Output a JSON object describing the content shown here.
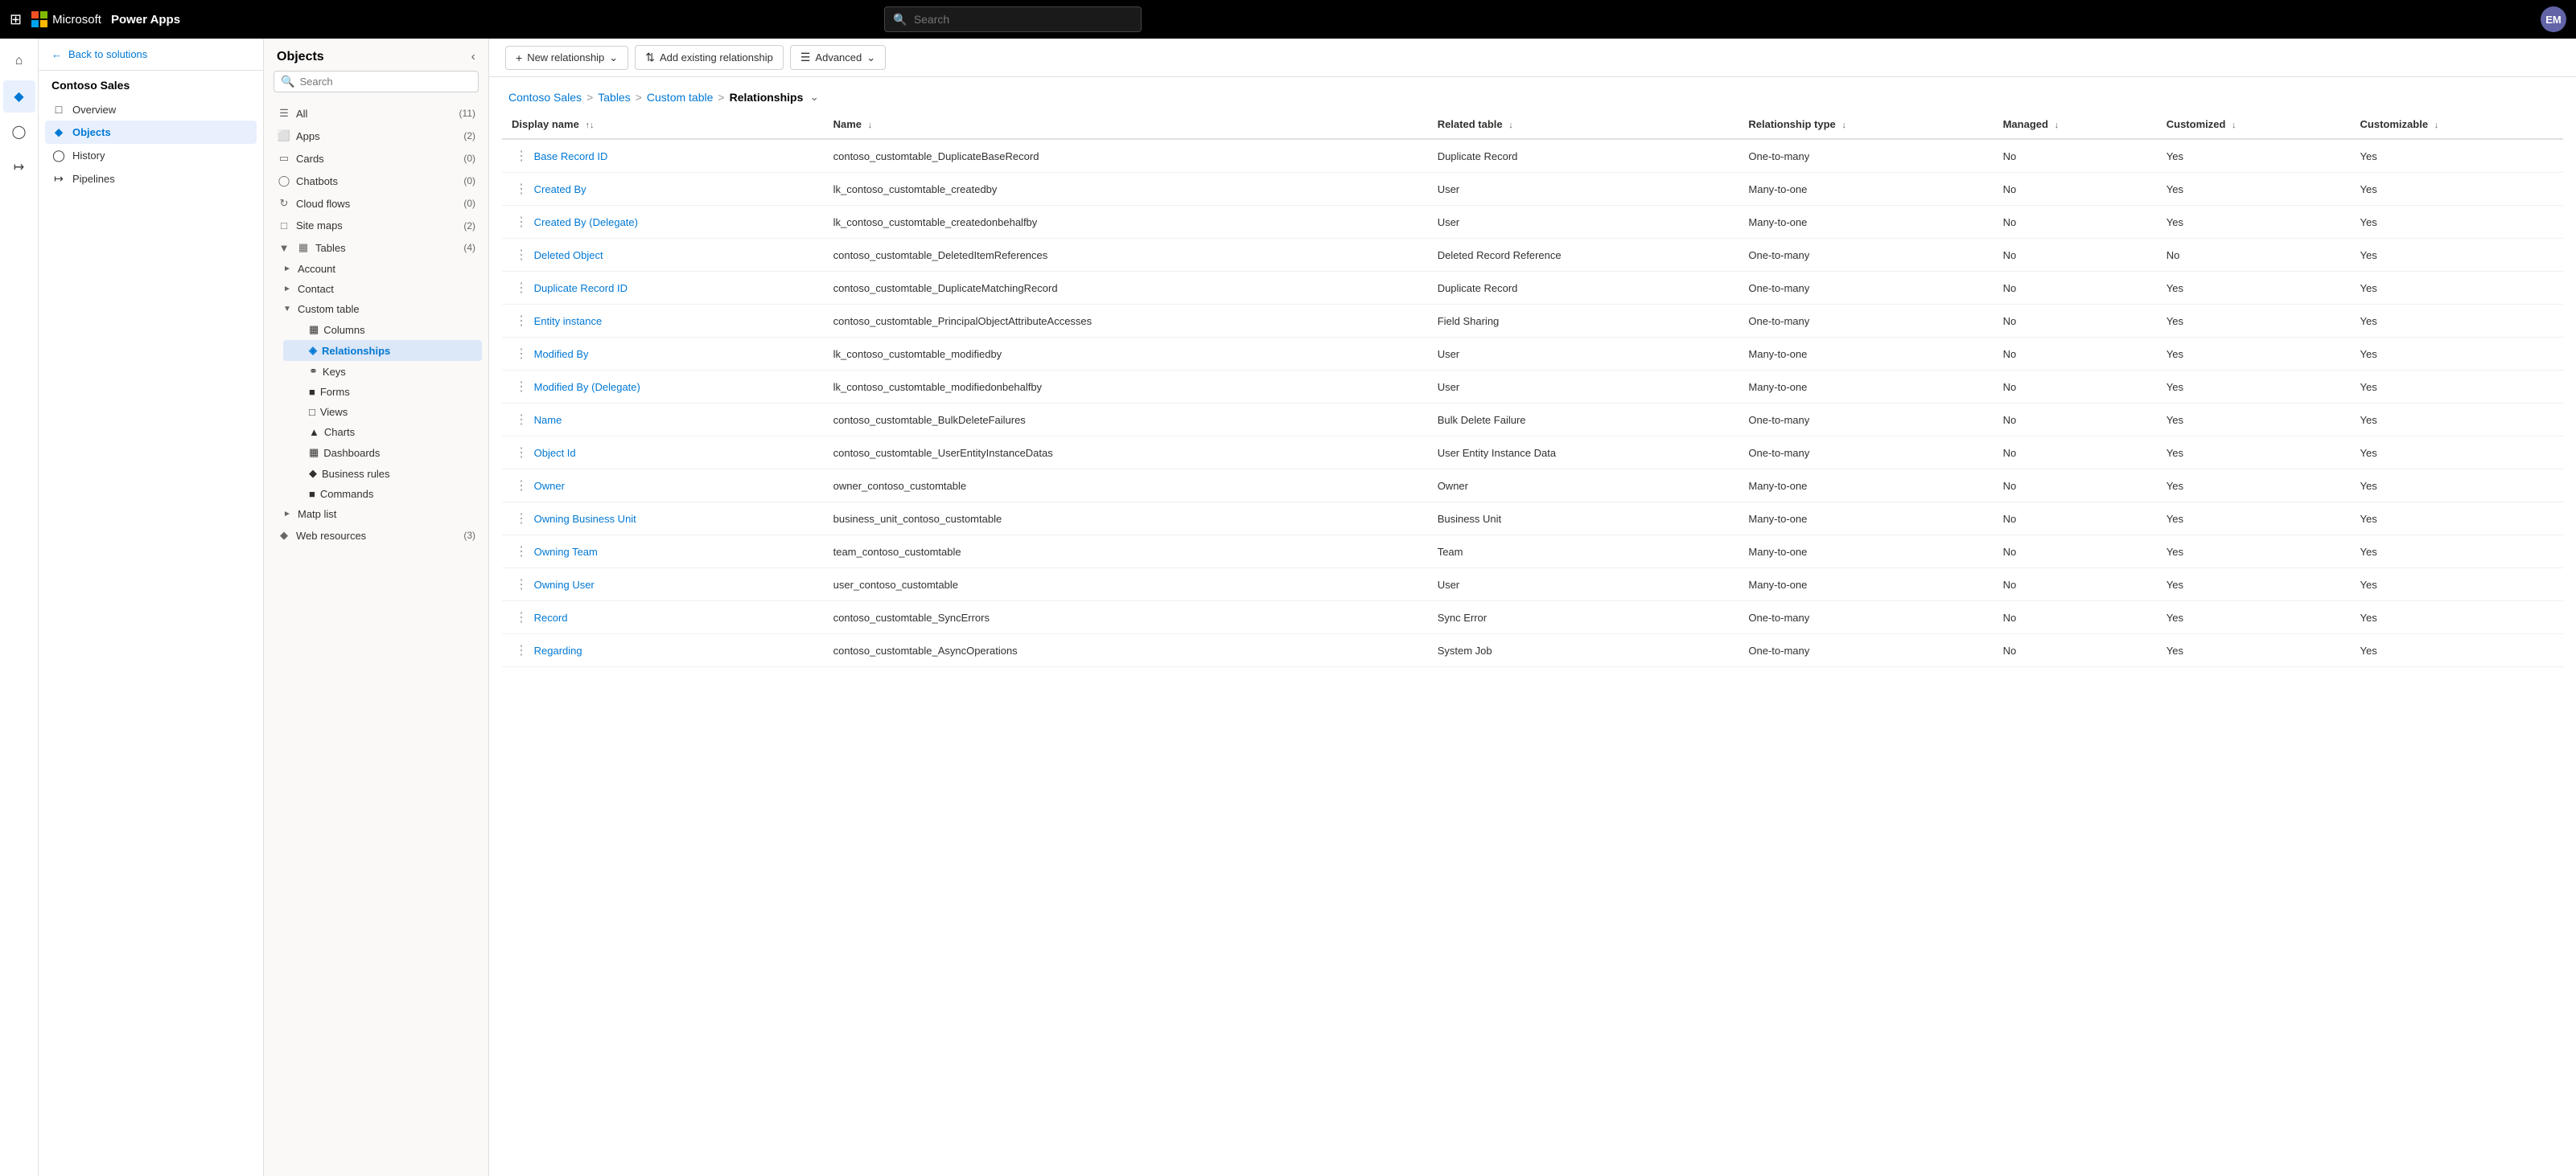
{
  "topNav": {
    "waffle": "⊞",
    "msText": "Microsoft",
    "appName": "Power Apps",
    "searchPlaceholder": "Search",
    "userInitials": "EM"
  },
  "leftNav": {
    "backLabel": "Back to solutions",
    "solutionName": "Contoso Sales",
    "items": [
      {
        "id": "overview",
        "icon": "◻",
        "label": "Overview"
      },
      {
        "id": "objects",
        "icon": "◈",
        "label": "Objects",
        "active": true
      },
      {
        "id": "history",
        "icon": "◷",
        "label": "History"
      },
      {
        "id": "pipelines",
        "icon": "⟼",
        "label": "Pipelines"
      }
    ]
  },
  "objectsPanel": {
    "title": "Objects",
    "searchPlaceholder": "Search",
    "items": [
      {
        "id": "all",
        "icon": "☰",
        "label": "All",
        "count": "(11)"
      },
      {
        "id": "apps",
        "icon": "⬚",
        "label": "Apps",
        "count": "(2)"
      },
      {
        "id": "cards",
        "icon": "▭",
        "label": "Cards",
        "count": "(0)"
      },
      {
        "id": "chatbots",
        "icon": "◉",
        "label": "Chatbots",
        "count": "(0)"
      },
      {
        "id": "cloudflows",
        "icon": "↻",
        "label": "Cloud flows",
        "count": "(0)"
      },
      {
        "id": "sitemaps",
        "icon": "⬜",
        "label": "Site maps",
        "count": "(2)"
      },
      {
        "id": "tables",
        "icon": "▦",
        "label": "Tables",
        "count": "(4)",
        "expanded": true,
        "children": [
          {
            "id": "account",
            "label": "Account",
            "expanded": false
          },
          {
            "id": "contact",
            "label": "Contact",
            "expanded": false
          },
          {
            "id": "customtable",
            "label": "Custom table",
            "expanded": true,
            "children": [
              {
                "id": "columns",
                "label": "Columns"
              },
              {
                "id": "relationships",
                "label": "Relationships",
                "active": true
              },
              {
                "id": "keys",
                "label": "Keys"
              },
              {
                "id": "forms",
                "label": "Forms"
              },
              {
                "id": "views",
                "label": "Views"
              },
              {
                "id": "charts",
                "label": "Charts"
              },
              {
                "id": "dashboards",
                "label": "Dashboards"
              },
              {
                "id": "businessrules",
                "label": "Business rules"
              },
              {
                "id": "commands",
                "label": "Commands"
              }
            ]
          },
          {
            "id": "maplist",
            "label": "Matp list",
            "expanded": false
          }
        ]
      },
      {
        "id": "webresources",
        "icon": "◈",
        "label": "Web resources",
        "count": "(3)"
      }
    ]
  },
  "toolbar": {
    "newRelationshipLabel": "New relationship",
    "addExistingLabel": "Add existing relationship",
    "advancedLabel": "Advanced"
  },
  "breadcrumb": {
    "items": [
      "Contoso Sales",
      "Tables",
      "Custom table"
    ],
    "current": "Relationships"
  },
  "table": {
    "columns": [
      {
        "id": "displayname",
        "label": "Display name",
        "sortable": true,
        "sortDir": "asc"
      },
      {
        "id": "name",
        "label": "Name",
        "sortable": true
      },
      {
        "id": "relatedtable",
        "label": "Related table",
        "sortable": true
      },
      {
        "id": "relationshiptype",
        "label": "Relationship type",
        "sortable": true
      },
      {
        "id": "managed",
        "label": "Managed",
        "sortable": true
      },
      {
        "id": "customized",
        "label": "Customized",
        "sortable": true
      },
      {
        "id": "customizable",
        "label": "Customizable",
        "sortable": true
      }
    ],
    "rows": [
      {
        "displayName": "Base Record ID",
        "name": "contoso_customtable_DuplicateBaseRecord",
        "relatedTable": "Duplicate Record",
        "relationshipType": "One-to-many",
        "managed": "No",
        "customized": "Yes",
        "customizable": "Yes"
      },
      {
        "displayName": "Created By",
        "name": "lk_contoso_customtable_createdby",
        "relatedTable": "User",
        "relationshipType": "Many-to-one",
        "managed": "No",
        "customized": "Yes",
        "customizable": "Yes"
      },
      {
        "displayName": "Created By (Delegate)",
        "name": "lk_contoso_customtable_createdonbehalfby",
        "relatedTable": "User",
        "relationshipType": "Many-to-one",
        "managed": "No",
        "customized": "Yes",
        "customizable": "Yes"
      },
      {
        "displayName": "Deleted Object",
        "name": "contoso_customtable_DeletedItemReferences",
        "relatedTable": "Deleted Record Reference",
        "relationshipType": "One-to-many",
        "managed": "No",
        "customized": "No",
        "customizable": "Yes"
      },
      {
        "displayName": "Duplicate Record ID",
        "name": "contoso_customtable_DuplicateMatchingRecord",
        "relatedTable": "Duplicate Record",
        "relationshipType": "One-to-many",
        "managed": "No",
        "customized": "Yes",
        "customizable": "Yes"
      },
      {
        "displayName": "Entity instance",
        "name": "contoso_customtable_PrincipalObjectAttributeAccesses",
        "relatedTable": "Field Sharing",
        "relationshipType": "One-to-many",
        "managed": "No",
        "customized": "Yes",
        "customizable": "Yes"
      },
      {
        "displayName": "Modified By",
        "name": "lk_contoso_customtable_modifiedby",
        "relatedTable": "User",
        "relationshipType": "Many-to-one",
        "managed": "No",
        "customized": "Yes",
        "customizable": "Yes"
      },
      {
        "displayName": "Modified By (Delegate)",
        "name": "lk_contoso_customtable_modifiedonbehalfby",
        "relatedTable": "User",
        "relationshipType": "Many-to-one",
        "managed": "No",
        "customized": "Yes",
        "customizable": "Yes"
      },
      {
        "displayName": "Name",
        "name": "contoso_customtable_BulkDeleteFailures",
        "relatedTable": "Bulk Delete Failure",
        "relationshipType": "One-to-many",
        "managed": "No",
        "customized": "Yes",
        "customizable": "Yes"
      },
      {
        "displayName": "Object Id",
        "name": "contoso_customtable_UserEntityInstanceDatas",
        "relatedTable": "User Entity Instance Data",
        "relationshipType": "One-to-many",
        "managed": "No",
        "customized": "Yes",
        "customizable": "Yes"
      },
      {
        "displayName": "Owner",
        "name": "owner_contoso_customtable",
        "relatedTable": "Owner",
        "relationshipType": "Many-to-one",
        "managed": "No",
        "customized": "Yes",
        "customizable": "Yes"
      },
      {
        "displayName": "Owning Business Unit",
        "name": "business_unit_contoso_customtable",
        "relatedTable": "Business Unit",
        "relationshipType": "Many-to-one",
        "managed": "No",
        "customized": "Yes",
        "customizable": "Yes"
      },
      {
        "displayName": "Owning Team",
        "name": "team_contoso_customtable",
        "relatedTable": "Team",
        "relationshipType": "Many-to-one",
        "managed": "No",
        "customized": "Yes",
        "customizable": "Yes"
      },
      {
        "displayName": "Owning User",
        "name": "user_contoso_customtable",
        "relatedTable": "User",
        "relationshipType": "Many-to-one",
        "managed": "No",
        "customized": "Yes",
        "customizable": "Yes"
      },
      {
        "displayName": "Record",
        "name": "contoso_customtable_SyncErrors",
        "relatedTable": "Sync Error",
        "relationshipType": "One-to-many",
        "managed": "No",
        "customized": "Yes",
        "customizable": "Yes"
      },
      {
        "displayName": "Regarding",
        "name": "contoso_customtable_AsyncOperations",
        "relatedTable": "System Job",
        "relationshipType": "One-to-many",
        "managed": "No",
        "customized": "Yes",
        "customizable": "Yes"
      }
    ]
  }
}
